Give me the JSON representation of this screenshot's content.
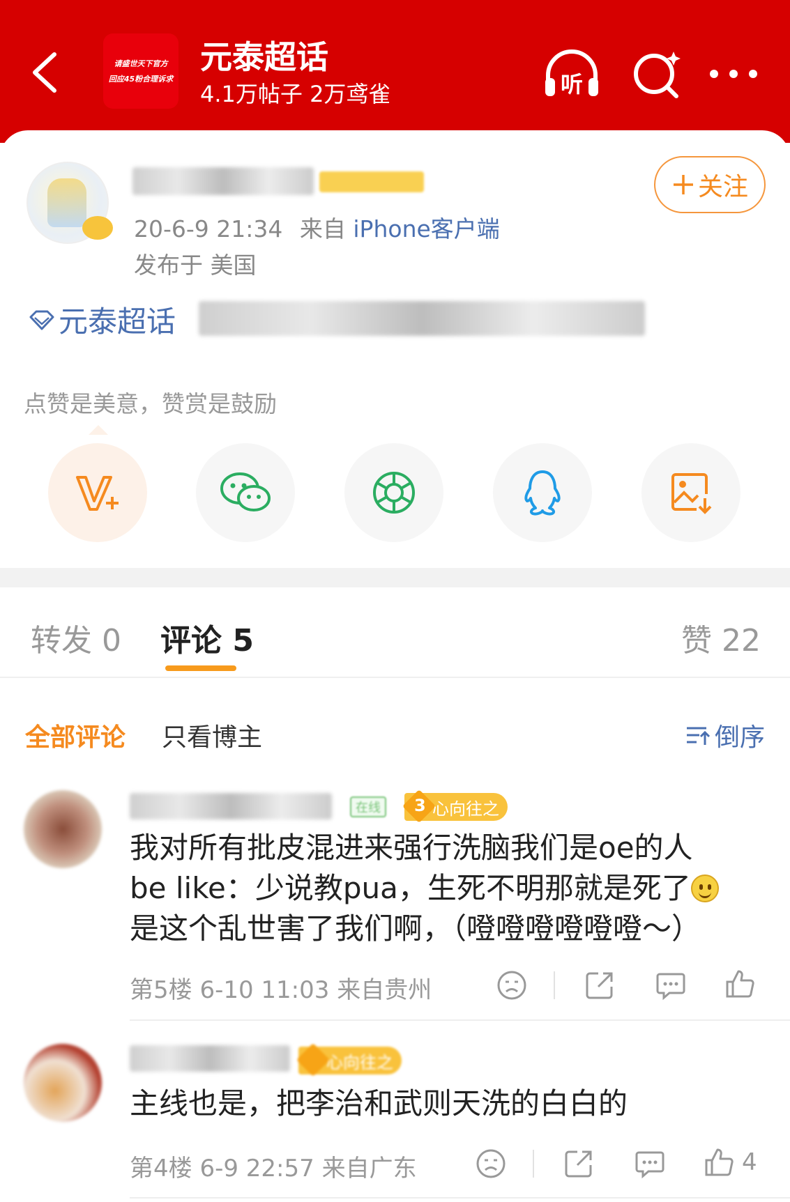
{
  "header": {
    "logo_line1": "请盛世天下官方",
    "logo_line2": "回应45粉合理诉求",
    "title": "元泰超话",
    "subtitle": "4.1万帖子 2万鸢雀",
    "icons": [
      "back-icon",
      "listen-icon",
      "search-icon",
      "more-icon"
    ],
    "listen_label": "听",
    "bg_color": "#d60000"
  },
  "post": {
    "meta_time": "20-6-9 21:34",
    "meta_from": "来自",
    "meta_source": "iPhone客户端",
    "location": "发布于 美国",
    "follow_label": "关注",
    "topic": "元泰超话",
    "reward_hint": "点赞是美意，赞赏是鼓励"
  },
  "share_icons": [
    "v-plus-icon",
    "wechat-icon",
    "moments-icon",
    "qq-icon",
    "save-image-icon"
  ],
  "tabs": [
    {
      "label": "转发 0"
    },
    {
      "label": "评论 5"
    },
    {
      "label": "赞 22"
    }
  ],
  "filters": {
    "all": "全部评论",
    "owner": "只看博主",
    "sort": "倒序"
  },
  "comments": [
    {
      "badge_online": "在线",
      "badge_level_num": "3",
      "badge_level_text": "心向往之",
      "line1": "我对所有批皮混进来强行洗脑我们是oe的人",
      "line2": "be like：少说教pua，生死不明那就是死了",
      "line3": "是这个乱世害了我们啊，（噔噔噔噔噔噔～）",
      "meta": "第5楼 6-10 11:03 来自贵州",
      "like_count": ""
    },
    {
      "badge_level_text": "心向往之",
      "line1": "主线也是，把李治和武则天洗的白白的",
      "meta": "第4楼 6-9 22:57 来自广东",
      "like_count": "4"
    }
  ],
  "colors": {
    "accent_orange": "#f58a1f",
    "link_blue": "#4a6fb0",
    "badge_yellow": "#f9c23c"
  }
}
